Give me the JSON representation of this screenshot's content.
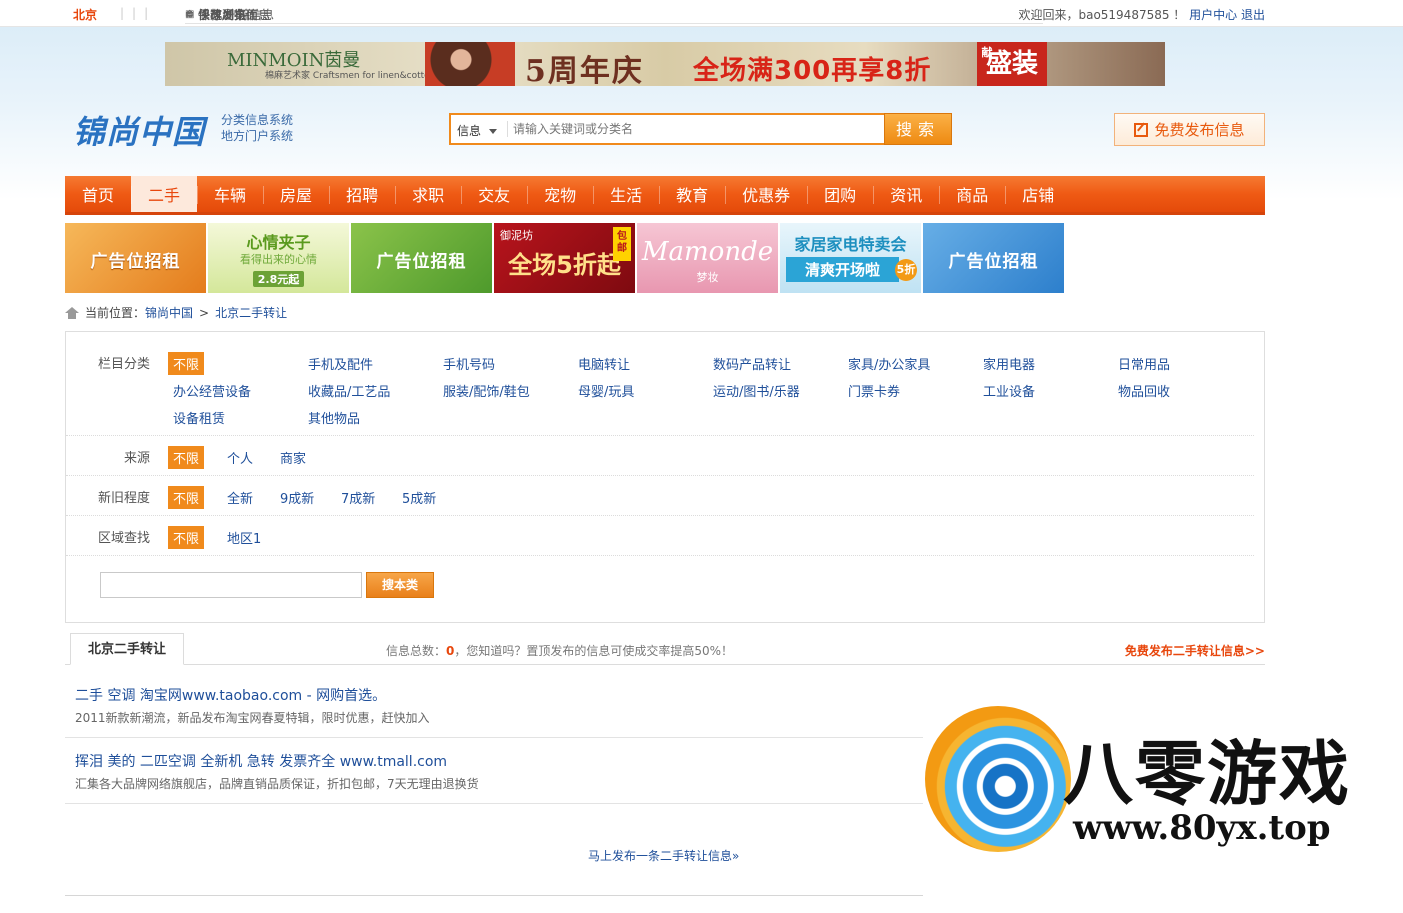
{
  "topbar": {
    "city": "北京",
    "links": [
      {
        "icon": "monitor-icon",
        "label": "保存到桌面"
      },
      {
        "icon": "lightning-icon",
        "label": "快速发布信息"
      },
      {
        "icon": "gear-icon",
        "label": "修改/删除信息"
      },
      {
        "icon": "qrcode-icon",
        "label": "手机浏览"
      }
    ],
    "welcome": "欢迎回来，bao519487585 ！",
    "user_center": "用户中心",
    "logout": "退出"
  },
  "banner": {
    "brand": "MINMOIN茵曼",
    "brand_sub": "棉麻艺术家 Craftsmen for linen&cotton",
    "anniversary": "5周年庆",
    "promo": "全场满300再享8折",
    "seal": "盛装",
    "seal_small": "献"
  },
  "logo": {
    "name": "锦尚中国",
    "sub1": "分类信息系统",
    "sub2": "地方门户系统"
  },
  "search": {
    "category": "信息",
    "placeholder": "请输入关键词或分类名",
    "button": "搜索"
  },
  "post_button": "免费发布信息",
  "nav": {
    "items": [
      "首页",
      "二手",
      "车辆",
      "房屋",
      "招聘",
      "求职",
      "交友",
      "宠物",
      "生活",
      "教育",
      "优惠券",
      "团购",
      "资讯",
      "商品",
      "店铺"
    ],
    "active": "二手"
  },
  "ads": [
    {
      "text": "广告位招租"
    },
    {
      "title": "心情夹子",
      "sub": "看得出来的心情",
      "price": "2.8元起"
    },
    {
      "text": "广告位招租"
    },
    {
      "brand": "御泥坊",
      "promo": "全场5折起",
      "tag": "包邮"
    },
    {
      "brand": "Mamonde",
      "sub": "梦妆"
    },
    {
      "title": "家居家电特卖会",
      "sub": "清爽开场啦",
      "badge": "5折"
    },
    {
      "text": "广告位招租"
    }
  ],
  "breadcrumb": {
    "prefix": "当前位置：",
    "home": "锦尚中国",
    "sep": ">",
    "current": "北京二手转让"
  },
  "filter": {
    "category_label": "栏目分类",
    "category_options": [
      "不限",
      "手机及配件",
      "手机号码",
      "电脑转让",
      "数码产品转让",
      "家具/办公家具",
      "家用电器",
      "日常用品",
      "办公经营设备",
      "收藏品/工艺品",
      "服装/配饰/鞋包",
      "母婴/玩具",
      "运动/图书/乐器",
      "门票卡券",
      "工业设备",
      "物品回收",
      "设备租赁",
      "其他物品"
    ],
    "source_label": "来源",
    "source_options": [
      "不限",
      "个人",
      "商家"
    ],
    "condition_label": "新旧程度",
    "condition_options": [
      "不限",
      "全新",
      "9成新",
      "7成新",
      "5成新"
    ],
    "area_label": "区域查找",
    "area_options": [
      "不限",
      "地区1"
    ],
    "search_value": "",
    "search_button": "搜本类"
  },
  "list": {
    "tab": "北京二手转让",
    "info_prefix": "信息总数：",
    "info_count": "0",
    "info_suffix": "，您知道吗？置顶发布的信息可使成交率提高50%！",
    "free_post": "免费发布二手转让信息>>",
    "items": [
      {
        "title": "二手 空调 淘宝网www.taobao.com - 网购首选。",
        "desc": "2011新款新潮流，新品发布淘宝网春夏特辑，限时优惠，赶快加入"
      },
      {
        "title": "挥泪 美的 二匹空调 全新机 急转 发票齐全 www.tmall.com",
        "desc": "汇集各大品牌网络旗舰店，品牌直销品质保证，折扣包邮，7天无理由退换货"
      }
    ],
    "post_more": "马上发布一条二手转让信息»"
  },
  "watermark": {
    "brand": "八零游戏",
    "url": "www.80yx.top"
  }
}
